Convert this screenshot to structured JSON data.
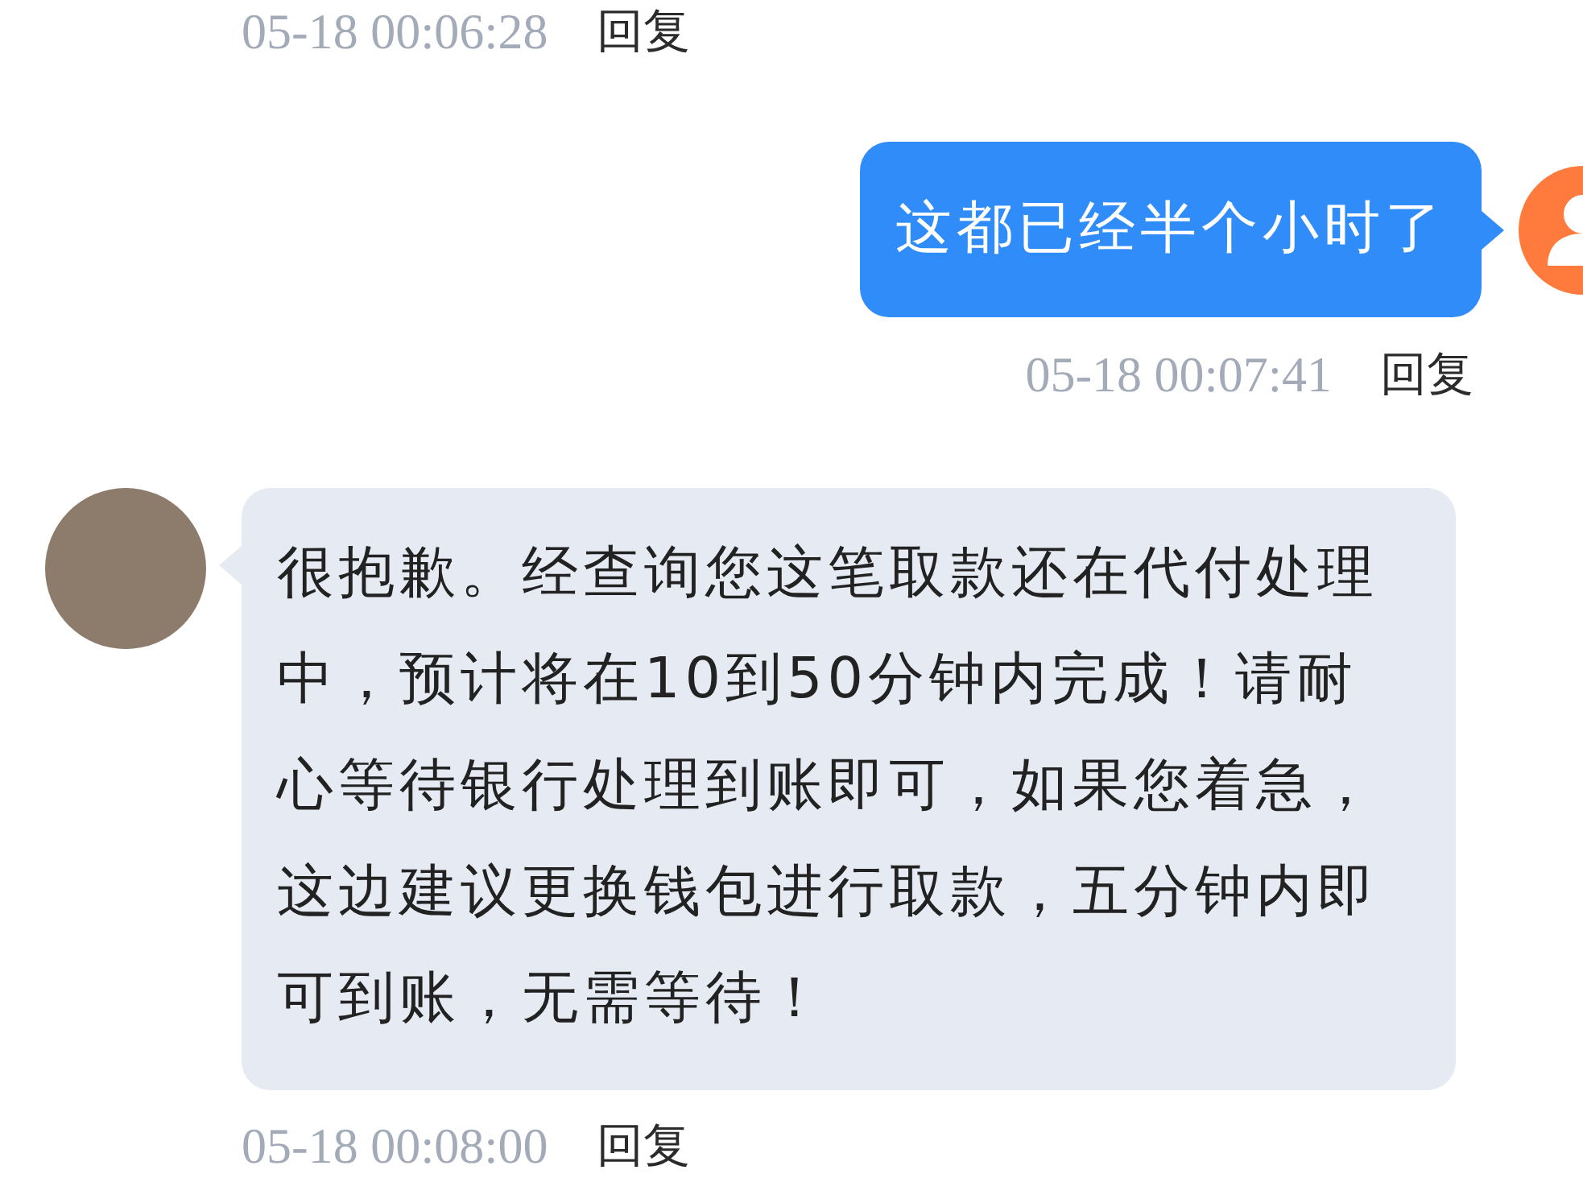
{
  "top_meta": {
    "time": "05-18 00:06:28",
    "reply": "回复"
  },
  "messages": [
    {
      "kind": "sent",
      "text": "这都已经半个小时了",
      "time": "05-18 00:07:41",
      "reply": "回复"
    },
    {
      "kind": "received",
      "text": "很抱歉。经查询您这笔取款还在代付处理中，预计将在10到50分钟内完成！请耐心等待银行处理到账即可，如果您着急，这边建议更换钱包进行取款，五分钟内即可到账，无需等待！",
      "time": "05-18 00:08:00",
      "reply": "回复"
    }
  ]
}
